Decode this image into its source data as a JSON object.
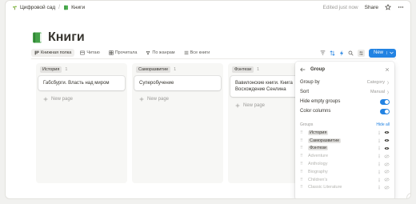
{
  "topbar": {
    "crumbs": [
      {
        "label": "Цифровой сад",
        "icon": "sprout-icon"
      },
      {
        "label": "Книги",
        "icon": "book-icon"
      }
    ],
    "separator": "/",
    "status": "Edited just now",
    "share_label": "Share"
  },
  "page": {
    "title": "Книги",
    "icon": "green-book-icon"
  },
  "views": [
    {
      "label": "Книжная полка",
      "active": true,
      "icon": "board-icon"
    },
    {
      "label": "Читаю",
      "icon": "table-icon"
    },
    {
      "label": "Прочитала",
      "icon": "gallery-icon"
    },
    {
      "label": "По жанрам",
      "icon": "genre-icon"
    },
    {
      "label": "Все книги",
      "icon": "list-icon"
    }
  ],
  "new_button": {
    "label": "New"
  },
  "board": {
    "columns": [
      {
        "tag": "История",
        "count": "1",
        "cards": [
          "Габсбурги. Власть над миром"
        ],
        "new_page": "New page"
      },
      {
        "tag": "Саморазвитие",
        "count": "1",
        "cards": [
          "Суперобучение"
        ],
        "new_page": "New page"
      },
      {
        "tag": "Фэнтези",
        "count": "1",
        "cards": [
          "Вавилонские книги. Книга Восхождение Сенлина"
        ],
        "new_page": "New page"
      }
    ]
  },
  "group_panel": {
    "title": "Group",
    "settings": [
      {
        "label": "Group by",
        "value": "Category"
      },
      {
        "label": "Sort",
        "value": "Manual"
      },
      {
        "label": "Hide empty groups",
        "toggle": true
      },
      {
        "label": "Color columns",
        "toggle": true
      }
    ],
    "groups_label": "Groups",
    "hide_all": "Hide all",
    "groups": [
      {
        "label": "История",
        "visible": true
      },
      {
        "label": "Саморазвитие",
        "visible": true
      },
      {
        "label": "Фэнтези",
        "visible": true
      },
      {
        "label": "Adventure",
        "visible": false
      },
      {
        "label": "Anthology",
        "visible": false
      },
      {
        "label": "Biography",
        "visible": false
      },
      {
        "label": "Children's",
        "visible": false
      },
      {
        "label": "Classic Literature",
        "visible": false
      }
    ]
  },
  "colors": {
    "accent": "#2383e2",
    "text": "#37352f",
    "muted": "#9b9a97"
  }
}
